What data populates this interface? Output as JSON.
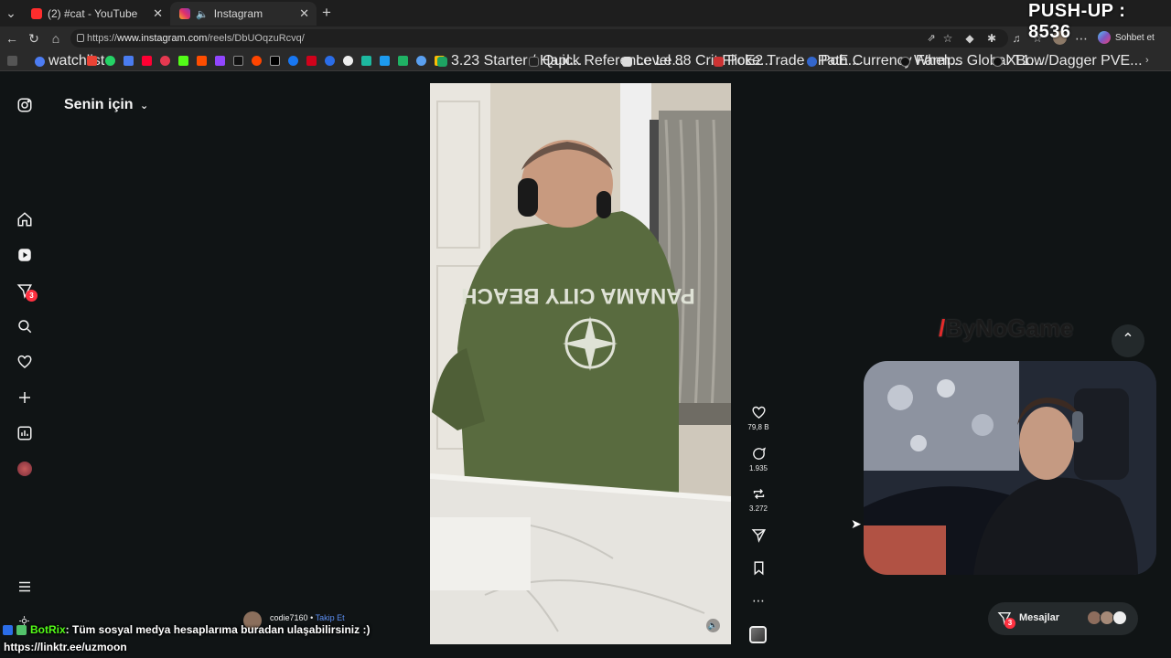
{
  "browser": {
    "tabs": [
      {
        "title": "(2) #cat - YouTube",
        "favicon_color": "#ff2d2d"
      },
      {
        "title": "Instagram",
        "favicon_color": "#e1306c"
      }
    ],
    "new_tab_glyph": "+",
    "url": {
      "prefix": "https://",
      "host": "www.instagram.com",
      "path": "/reels/DbUOqzuRcvq/"
    },
    "profile_chat_label": "Sohbet et",
    "bookmarks": [
      {
        "label": "watchlist",
        "icon_color": "#4c7cf3"
      },
      {
        "label": "3.23 Starter / Hapl...",
        "icon_color": "#1ea362"
      },
      {
        "label": "Quick Reference Le...",
        "icon_color": "#222222"
      },
      {
        "label": "Level 88 Crit Flicke...",
        "icon_color": "#dddddd"
      },
      {
        "label": "PoE2 Trade - Path...",
        "icon_color": "#cc3333"
      },
      {
        "label": "PoE Currency Farm...",
        "icon_color": "#3366cc"
      },
      {
        "label": "Whelps Global T1...",
        "icon_color": "#111111"
      },
      {
        "label": "XBow/Dagger PVE...",
        "icon_color": "#111111"
      }
    ]
  },
  "overlay": {
    "pushup_counter": "PUSH-UP : 8536",
    "streamer_logo": "ByNoGame",
    "chat_user": "BotRix",
    "chat_message": ": Tüm sosyal medya hesaplarıma buradan ulaşabilirsiniz :)",
    "chat_link": "https://linktr.ee/uzmoon"
  },
  "instagram": {
    "feed_selector": "Senin için",
    "nav": [
      {
        "name": "home-icon"
      },
      {
        "name": "reels-icon"
      },
      {
        "name": "messages-icon",
        "badge": "3"
      },
      {
        "name": "search-icon"
      },
      {
        "name": "notifications-icon"
      },
      {
        "name": "create-icon"
      },
      {
        "name": "dashboard-icon"
      },
      {
        "name": "profile-avatar"
      }
    ],
    "reel": {
      "author": "codie7160",
      "follow_label": "Takip Et",
      "likes": "79,8 B",
      "comments": "1.935",
      "reposts": "3.272"
    },
    "messages_label": "Mesajlar",
    "messages_badge": "3"
  }
}
